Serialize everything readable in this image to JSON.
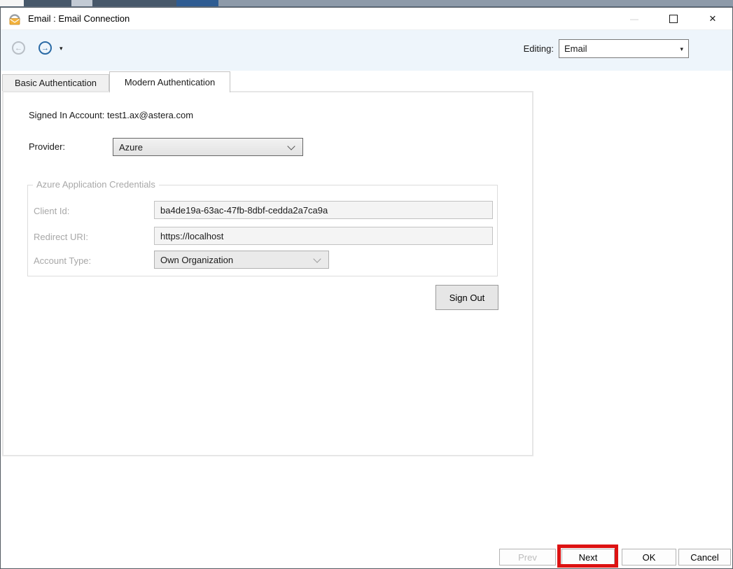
{
  "window": {
    "title": "Email : Email Connection"
  },
  "icons": {
    "back": "←",
    "forward": "→",
    "caret": "▾",
    "minimize": "—",
    "close": "✕"
  },
  "toolbar": {
    "editing_label": "Editing:",
    "editing_value": "Email"
  },
  "tabs": [
    {
      "label": "Basic Authentication",
      "selected": false
    },
    {
      "label": "Modern Authentication",
      "selected": true
    }
  ],
  "content": {
    "signed_in_label": "Signed In Account: ",
    "signed_in_value": "test1.ax@astera.com",
    "provider_label": "Provider:",
    "provider_value": "Azure",
    "credentials_group": {
      "title": "Azure Application Credentials",
      "fields": [
        {
          "label": "Client Id:",
          "value": "ba4de19a-63ac-47fb-8dbf-cedda2a7ca9a"
        },
        {
          "label": "Redirect URI:",
          "value": "https://localhost"
        },
        {
          "label": "Account Type:",
          "value": "Own Organization"
        }
      ]
    },
    "sign_out_label": "Sign Out"
  },
  "footer": {
    "prev_label": "Prev",
    "next_label": "Next",
    "ok_label": "OK",
    "cancel_label": "Cancel"
  },
  "colors": {
    "toolbar_bg": "#eef5fb",
    "accent_blue": "#2a6aa5",
    "annotation_red": "#dd1212",
    "disabled_text": "#bcbcbc"
  }
}
